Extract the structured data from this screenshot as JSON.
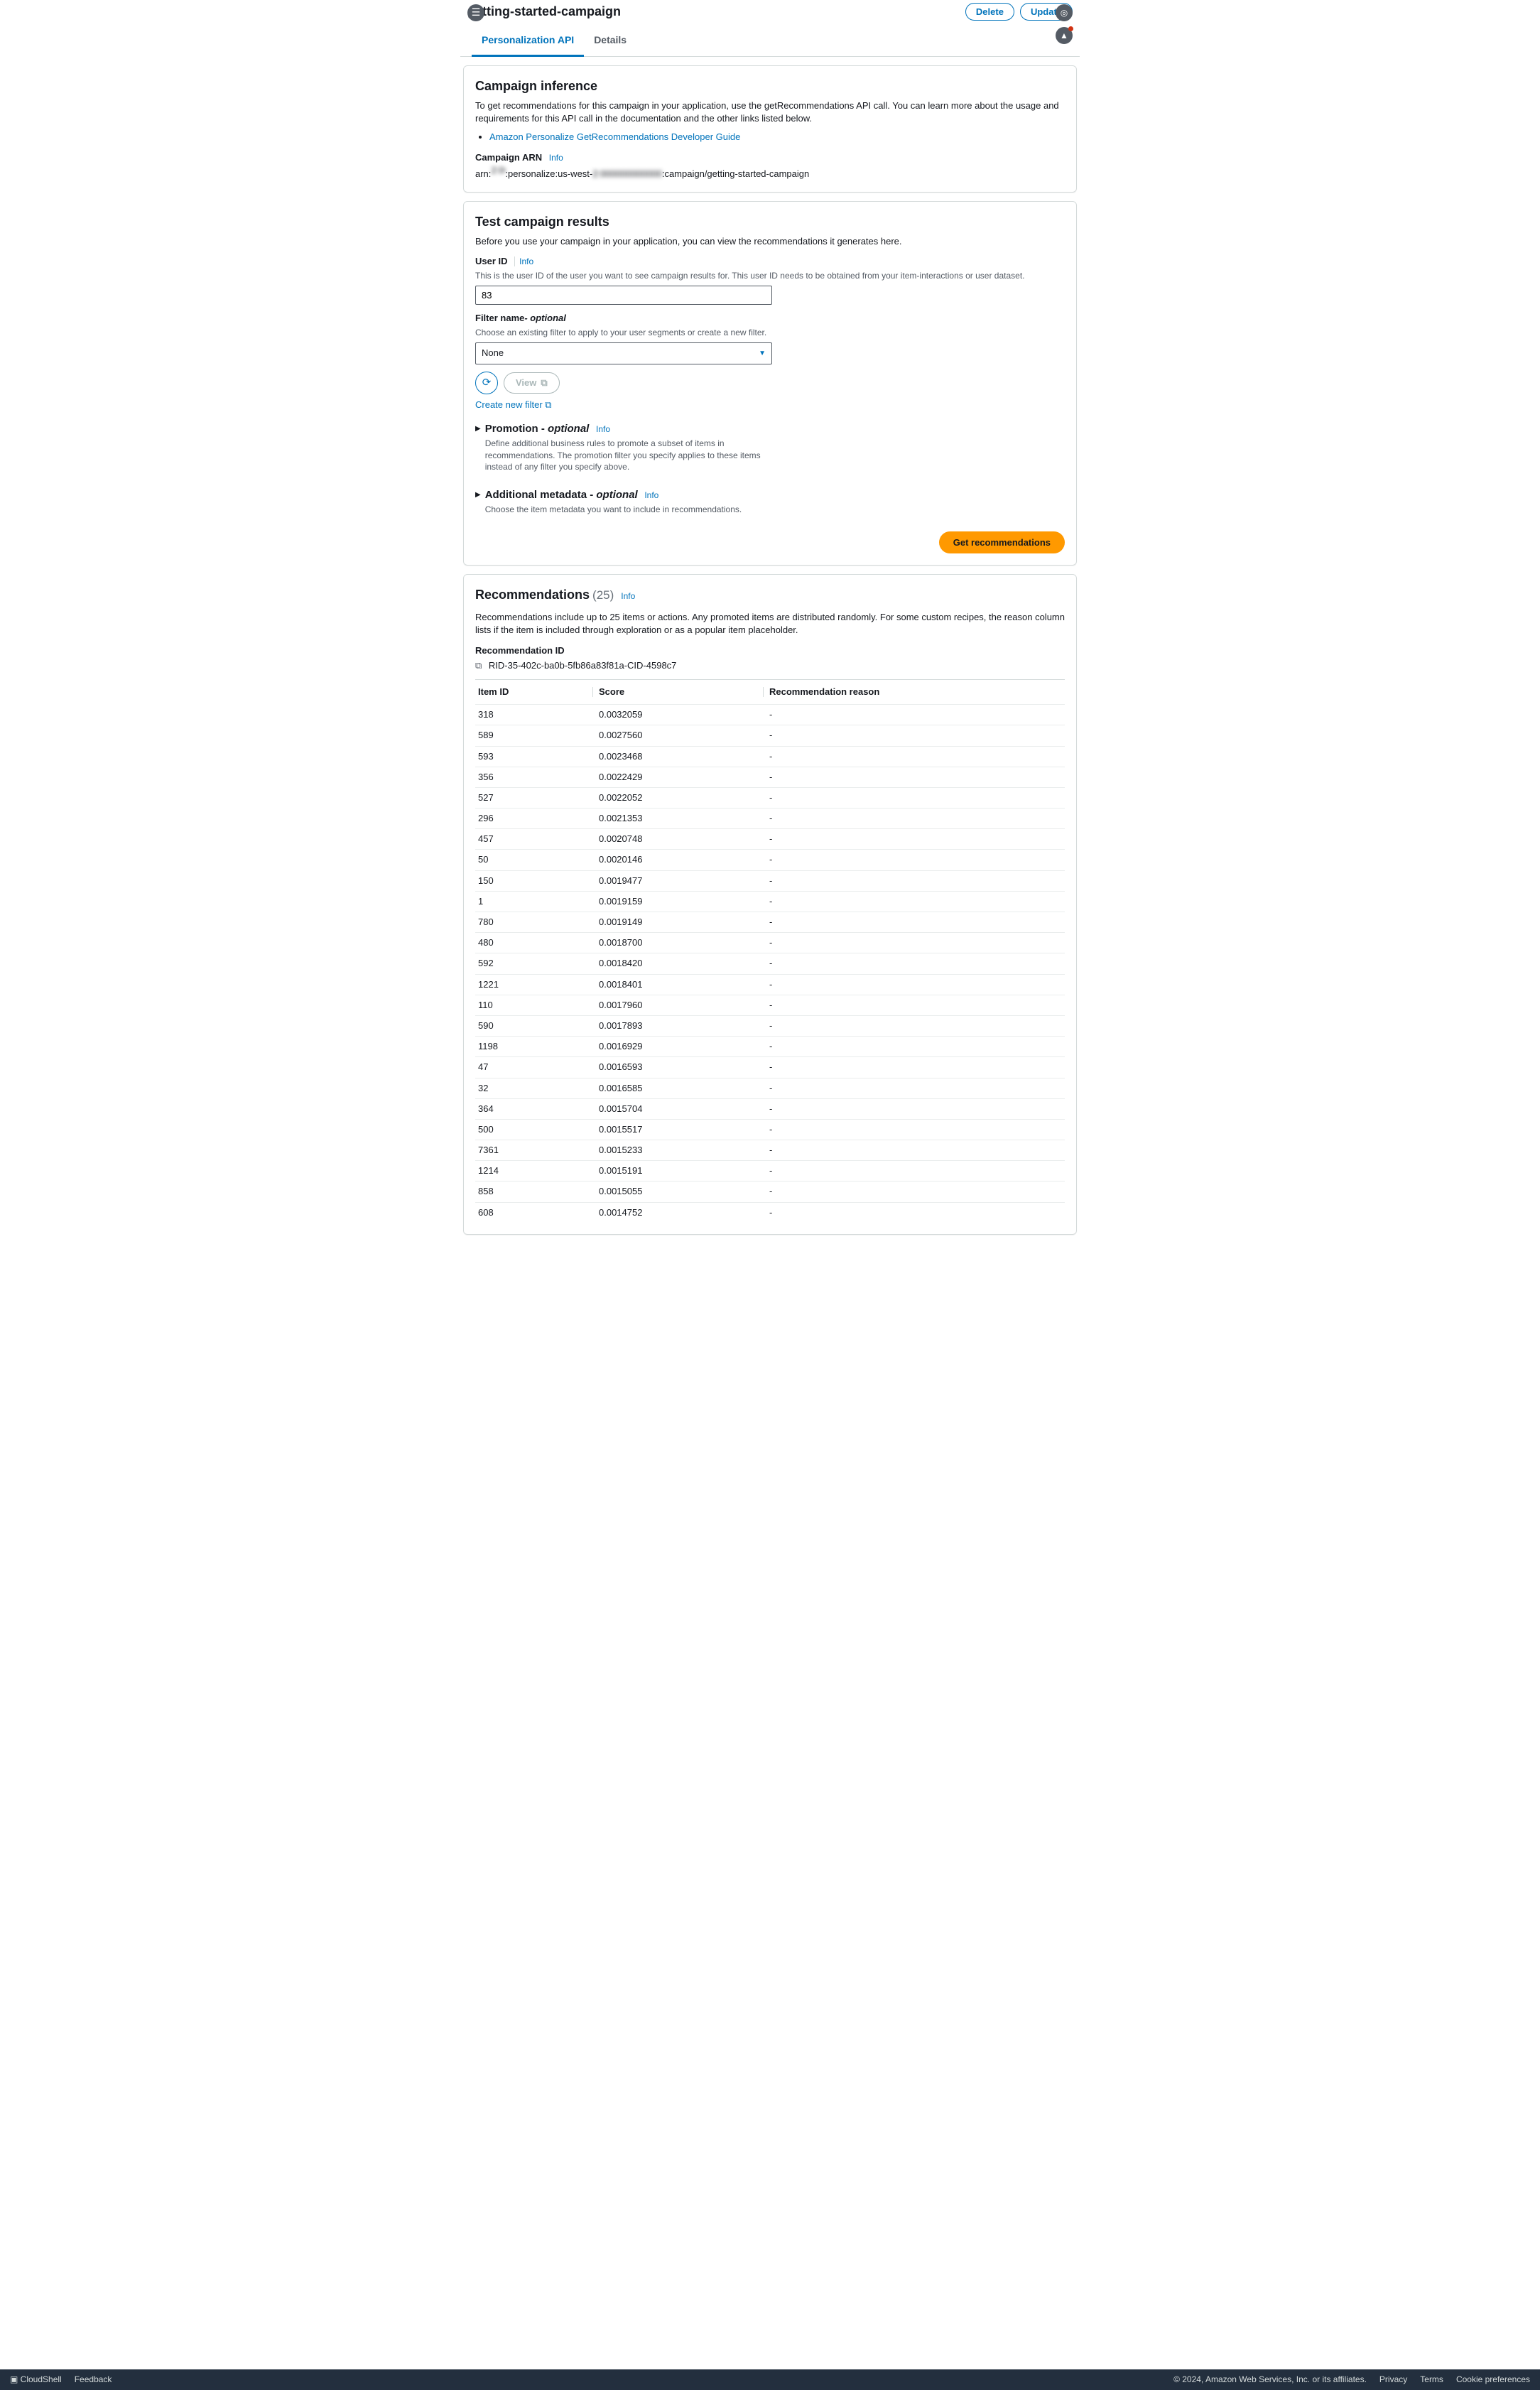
{
  "header": {
    "title": "getting-started-campaign",
    "delete": "Delete",
    "update": "Update"
  },
  "tabs": {
    "t1": "Personalization API",
    "t2": "Details"
  },
  "inference": {
    "title": "Campaign inference",
    "desc": "To get recommendations for this campaign in your application, use the getRecommendations API call. You can learn more about the usage and requirements for this API call in the documentation and the other links listed below.",
    "guide": "Amazon Personalize GetRecommendations Developer Guide",
    "arn_label": "Campaign ARN",
    "info": "Info",
    "arn_pre": "arn:",
    "arn_mid": ":personalize:us-west-",
    "arn_blur": "2:000000000000",
    "arn_post": ":campaign/getting-started-campaign"
  },
  "test": {
    "title": "Test campaign results",
    "desc": "Before you use your campaign in your application, you can view the recommendations it generates here.",
    "userid_label": "User ID",
    "info": "Info",
    "userid_desc": "This is the user ID of the user you want to see campaign results for. This user ID needs to be obtained from your item-interactions or user dataset.",
    "userid_value": "83",
    "filter_label": "Filter name",
    "optional": "- optional",
    "filter_desc": "Choose an existing filter to apply to your user segments or create a new filter.",
    "filter_value": "None",
    "view": "View",
    "create_filter": "Create new filter",
    "promo_title": "Promotion -",
    "promo_opt": "optional",
    "promo_desc": "Define additional business rules to promote a subset of items in recommendations. The promotion filter you specify applies to these items instead of any filter you specify above.",
    "meta_title": "Additional metadata -",
    "meta_opt": "optional",
    "meta_desc": "Choose the item metadata you want to include in recommendations.",
    "get_btn": "Get recommendations"
  },
  "recs": {
    "title": "Recommendations",
    "count": "(25)",
    "info": "Info",
    "desc": "Recommendations include up to 25 items or actions. Any promoted items are distributed randomly. For some custom recipes, the reason column lists if the item is included through exploration or as a popular item placeholder.",
    "rid_label": "Recommendation ID",
    "rid": "RID-35-402c-ba0b-5fb86a83f81a-CID-4598c7",
    "col1": "Item ID",
    "col2": "Score",
    "col3": "Recommendation reason",
    "rows": [
      {
        "id": "318",
        "score": "0.0032059",
        "reason": "-"
      },
      {
        "id": "589",
        "score": "0.0027560",
        "reason": "-"
      },
      {
        "id": "593",
        "score": "0.0023468",
        "reason": "-"
      },
      {
        "id": "356",
        "score": "0.0022429",
        "reason": "-"
      },
      {
        "id": "527",
        "score": "0.0022052",
        "reason": "-"
      },
      {
        "id": "296",
        "score": "0.0021353",
        "reason": "-"
      },
      {
        "id": "457",
        "score": "0.0020748",
        "reason": "-"
      },
      {
        "id": "50",
        "score": "0.0020146",
        "reason": "-"
      },
      {
        "id": "150",
        "score": "0.0019477",
        "reason": "-"
      },
      {
        "id": "1",
        "score": "0.0019159",
        "reason": "-"
      },
      {
        "id": "780",
        "score": "0.0019149",
        "reason": "-"
      },
      {
        "id": "480",
        "score": "0.0018700",
        "reason": "-"
      },
      {
        "id": "592",
        "score": "0.0018420",
        "reason": "-"
      },
      {
        "id": "1221",
        "score": "0.0018401",
        "reason": "-"
      },
      {
        "id": "110",
        "score": "0.0017960",
        "reason": "-"
      },
      {
        "id": "590",
        "score": "0.0017893",
        "reason": "-"
      },
      {
        "id": "1198",
        "score": "0.0016929",
        "reason": "-"
      },
      {
        "id": "47",
        "score": "0.0016593",
        "reason": "-"
      },
      {
        "id": "32",
        "score": "0.0016585",
        "reason": "-"
      },
      {
        "id": "364",
        "score": "0.0015704",
        "reason": "-"
      },
      {
        "id": "500",
        "score": "0.0015517",
        "reason": "-"
      },
      {
        "id": "7361",
        "score": "0.0015233",
        "reason": "-"
      },
      {
        "id": "1214",
        "score": "0.0015191",
        "reason": "-"
      },
      {
        "id": "858",
        "score": "0.0015055",
        "reason": "-"
      },
      {
        "id": "608",
        "score": "0.0014752",
        "reason": "-"
      }
    ]
  },
  "footer": {
    "cloudshell": "CloudShell",
    "feedback": "Feedback",
    "copyright": "© 2024, Amazon Web Services, Inc. or its affiliates.",
    "privacy": "Privacy",
    "terms": "Terms",
    "cookies": "Cookie preferences"
  }
}
